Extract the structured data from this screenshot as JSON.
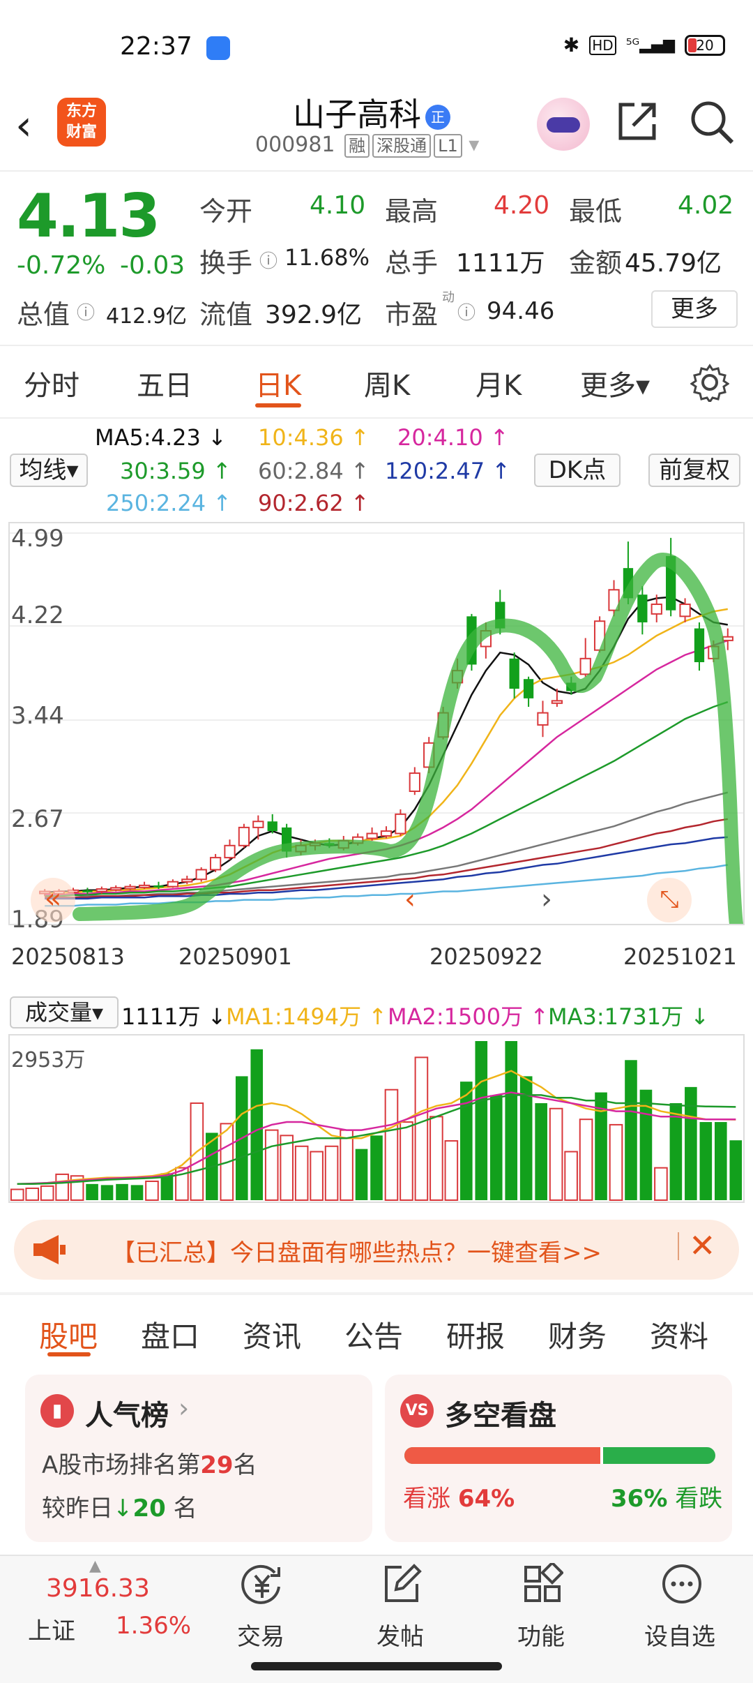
{
  "status": {
    "time": "22:37",
    "battery": "20"
  },
  "header": {
    "logo_line1": "东方",
    "logo_line2": "财富",
    "name": "山子高科",
    "badge": "正",
    "code": "000981",
    "tags": [
      "融",
      "深股通",
      "L1"
    ]
  },
  "quote": {
    "price": "4.13",
    "change_pct": "-0.72%",
    "change": "-0.03",
    "open_label": "今开",
    "open": "4.10",
    "high_label": "最高",
    "high": "4.20",
    "low_label": "最低",
    "low": "4.02",
    "turnover_label": "换手",
    "turnover": "11.68%",
    "volume_label": "总手",
    "volume": "1111万",
    "amount_label": "金额",
    "amount": "45.79亿",
    "mktcap_label": "总值",
    "mktcap": "412.9亿",
    "float_label": "流值",
    "float": "392.9亿",
    "pe_label": "市盈",
    "pe_sup": "动",
    "pe": "94.46",
    "more": "更多"
  },
  "ktabs": [
    {
      "label": "分时"
    },
    {
      "label": "五日"
    },
    {
      "label": "日K"
    },
    {
      "label": "周K"
    },
    {
      "label": "月K"
    },
    {
      "label": "更多▾"
    }
  ],
  "ma": {
    "selector": "均线▾",
    "ma5": "MA5:4.23 ↓",
    "ma10": "10:4.36 ↑",
    "ma20": "20:4.10 ↑",
    "ma30": "30:3.59 ↑",
    "ma60": "60:2.84 ↑",
    "ma120": "120:2.47 ↑",
    "ma250": "250:2.24 ↑",
    "ma90": "90:2.62 ↑",
    "dk": "DK点",
    "fq": "前复权"
  },
  "chart_data": {
    "type": "candlestick",
    "y_ticks": [
      "4.99",
      "4.22",
      "3.44",
      "2.67",
      "1.89"
    ],
    "ylim": [
      1.89,
      4.99
    ],
    "x_ticks": [
      "20250813",
      "20250901",
      "20250922",
      "20251021"
    ],
    "candles": [
      {
        "o": 2.02,
        "c": 2.02,
        "h": 2.04,
        "l": 1.98,
        "up": true
      },
      {
        "o": 2.0,
        "c": 2.02,
        "h": 2.04,
        "l": 1.98,
        "up": true
      },
      {
        "o": 2.02,
        "c": 2.03,
        "h": 2.05,
        "l": 2.0,
        "up": true
      },
      {
        "o": 2.03,
        "c": 2.02,
        "h": 2.05,
        "l": 2.0,
        "up": false
      },
      {
        "o": 2.02,
        "c": 2.04,
        "h": 2.06,
        "l": 2.0,
        "up": true
      },
      {
        "o": 2.04,
        "c": 2.05,
        "h": 2.07,
        "l": 2.02,
        "up": true
      },
      {
        "o": 2.05,
        "c": 2.06,
        "h": 2.08,
        "l": 2.03,
        "up": true
      },
      {
        "o": 2.06,
        "c": 2.07,
        "h": 2.1,
        "l": 2.04,
        "up": true
      },
      {
        "o": 2.07,
        "c": 2.06,
        "h": 2.1,
        "l": 2.04,
        "up": false
      },
      {
        "o": 2.06,
        "c": 2.1,
        "h": 2.12,
        "l": 2.05,
        "up": true
      },
      {
        "o": 2.1,
        "c": 2.12,
        "h": 2.15,
        "l": 2.08,
        "up": true
      },
      {
        "o": 2.12,
        "c": 2.2,
        "h": 2.22,
        "l": 2.1,
        "up": true
      },
      {
        "o": 2.2,
        "c": 2.3,
        "h": 2.33,
        "l": 2.18,
        "up": true
      },
      {
        "o": 2.3,
        "c": 2.4,
        "h": 2.45,
        "l": 2.28,
        "up": true
      },
      {
        "o": 2.4,
        "c": 2.55,
        "h": 2.58,
        "l": 2.38,
        "up": true
      },
      {
        "o": 2.55,
        "c": 2.6,
        "h": 2.65,
        "l": 2.45,
        "up": true
      },
      {
        "o": 2.6,
        "c": 2.52,
        "h": 2.66,
        "l": 2.5,
        "up": false
      },
      {
        "o": 2.55,
        "c": 2.35,
        "h": 2.58,
        "l": 2.3,
        "up": false
      },
      {
        "o": 2.35,
        "c": 2.4,
        "h": 2.45,
        "l": 2.32,
        "up": true
      },
      {
        "o": 2.4,
        "c": 2.42,
        "h": 2.45,
        "l": 2.36,
        "up": true
      },
      {
        "o": 2.42,
        "c": 2.4,
        "h": 2.46,
        "l": 2.38,
        "up": false
      },
      {
        "o": 2.38,
        "c": 2.44,
        "h": 2.48,
        "l": 2.36,
        "up": true
      },
      {
        "o": 2.42,
        "c": 2.47,
        "h": 2.5,
        "l": 2.4,
        "up": true
      },
      {
        "o": 2.46,
        "c": 2.5,
        "h": 2.55,
        "l": 2.44,
        "up": true
      },
      {
        "o": 2.48,
        "c": 2.52,
        "h": 2.56,
        "l": 2.46,
        "up": true
      },
      {
        "o": 2.5,
        "c": 2.66,
        "h": 2.7,
        "l": 2.48,
        "up": true
      },
      {
        "o": 2.85,
        "c": 3.0,
        "h": 3.05,
        "l": 2.82,
        "up": true
      },
      {
        "o": 3.05,
        "c": 3.25,
        "h": 3.3,
        "l": 3.0,
        "up": true
      },
      {
        "o": 3.3,
        "c": 3.5,
        "h": 3.55,
        "l": 3.28,
        "up": true
      },
      {
        "o": 3.75,
        "c": 3.85,
        "h": 3.95,
        "l": 3.7,
        "up": true
      },
      {
        "o": 4.3,
        "c": 3.9,
        "h": 4.32,
        "l": 3.85,
        "up": false
      },
      {
        "o": 4.05,
        "c": 4.18,
        "h": 4.25,
        "l": 3.95,
        "up": true
      },
      {
        "o": 4.42,
        "c": 4.2,
        "h": 4.52,
        "l": 4.15,
        "up": false
      },
      {
        "o": 3.95,
        "c": 3.7,
        "h": 4.0,
        "l": 3.62,
        "up": false
      },
      {
        "o": 3.78,
        "c": 3.62,
        "h": 3.8,
        "l": 3.55,
        "up": false
      },
      {
        "o": 3.5,
        "c": 3.4,
        "h": 3.6,
        "l": 3.3,
        "up": true
      },
      {
        "o": 3.58,
        "c": 3.6,
        "h": 3.7,
        "l": 3.55,
        "up": true
      },
      {
        "o": 3.75,
        "c": 3.68,
        "h": 3.8,
        "l": 3.65,
        "up": false
      },
      {
        "o": 3.82,
        "c": 3.95,
        "h": 4.12,
        "l": 3.8,
        "up": true
      },
      {
        "o": 4.02,
        "c": 4.26,
        "h": 4.3,
        "l": 4.0,
        "up": true
      },
      {
        "o": 4.52,
        "c": 4.35,
        "h": 4.6,
        "l": 4.3,
        "up": true
      },
      {
        "o": 4.7,
        "c": 4.45,
        "h": 4.92,
        "l": 4.4,
        "up": false
      },
      {
        "o": 4.48,
        "c": 4.25,
        "h": 4.55,
        "l": 4.15,
        "up": false
      },
      {
        "o": 4.32,
        "c": 4.4,
        "h": 4.48,
        "l": 4.25,
        "up": true
      },
      {
        "o": 4.8,
        "c": 4.35,
        "h": 4.95,
        "l": 4.3,
        "up": false
      },
      {
        "o": 4.4,
        "c": 4.3,
        "h": 4.45,
        "l": 4.25,
        "up": true
      },
      {
        "o": 4.2,
        "c": 3.92,
        "h": 4.25,
        "l": 3.85,
        "up": false
      },
      {
        "o": 4.05,
        "c": 3.95,
        "h": 4.1,
        "l": 3.92,
        "up": true
      },
      {
        "o": 4.1,
        "c": 4.13,
        "h": 4.2,
        "l": 4.02,
        "up": true
      }
    ],
    "ma_lines": [
      {
        "name": "MA5",
        "color": "#111111",
        "values": [
          2.01,
          2.02,
          2.02,
          2.03,
          2.03,
          2.04,
          2.05,
          2.06,
          2.06,
          2.08,
          2.1,
          2.14,
          2.2,
          2.28,
          2.38,
          2.48,
          2.52,
          2.48,
          2.45,
          2.42,
          2.4,
          2.41,
          2.43,
          2.46,
          2.48,
          2.55,
          2.7,
          2.9,
          3.15,
          3.4,
          3.65,
          3.85,
          4.0,
          3.98,
          3.9,
          3.75,
          3.68,
          3.66,
          3.7,
          3.85,
          4.05,
          4.28,
          4.42,
          4.45,
          4.46,
          4.4,
          4.32,
          4.25,
          4.23
        ]
      },
      {
        "name": "MA10",
        "color": "#f0b419",
        "values": [
          2.0,
          2.01,
          2.01,
          2.02,
          2.02,
          2.03,
          2.03,
          2.04,
          2.05,
          2.06,
          2.07,
          2.09,
          2.12,
          2.16,
          2.22,
          2.28,
          2.34,
          2.38,
          2.4,
          2.42,
          2.44,
          2.44,
          2.44,
          2.45,
          2.46,
          2.48,
          2.55,
          2.64,
          2.76,
          2.9,
          3.08,
          3.28,
          3.48,
          3.62,
          3.72,
          3.78,
          3.8,
          3.82,
          3.85,
          3.88,
          3.92,
          3.98,
          4.06,
          4.14,
          4.2,
          4.26,
          4.3,
          4.34,
          4.36
        ]
      },
      {
        "name": "MA20",
        "color": "#d6279e",
        "values": [
          1.99,
          1.99,
          2.0,
          2.0,
          2.01,
          2.01,
          2.02,
          2.02,
          2.03,
          2.04,
          2.05,
          2.06,
          2.07,
          2.09,
          2.11,
          2.14,
          2.17,
          2.2,
          2.23,
          2.26,
          2.29,
          2.31,
          2.33,
          2.35,
          2.37,
          2.4,
          2.44,
          2.49,
          2.55,
          2.62,
          2.7,
          2.8,
          2.9,
          3.0,
          3.1,
          3.2,
          3.3,
          3.38,
          3.46,
          3.54,
          3.62,
          3.7,
          3.78,
          3.86,
          3.92,
          3.98,
          4.02,
          4.06,
          4.1
        ]
      },
      {
        "name": "MA30",
        "color": "#1d9a2a",
        "values": [
          1.98,
          1.98,
          1.99,
          1.99,
          2.0,
          2.0,
          2.01,
          2.01,
          2.02,
          2.02,
          2.03,
          2.04,
          2.05,
          2.06,
          2.08,
          2.1,
          2.12,
          2.14,
          2.16,
          2.18,
          2.2,
          2.22,
          2.24,
          2.26,
          2.28,
          2.3,
          2.33,
          2.36,
          2.4,
          2.45,
          2.5,
          2.56,
          2.62,
          2.68,
          2.74,
          2.8,
          2.86,
          2.92,
          2.98,
          3.04,
          3.1,
          3.17,
          3.24,
          3.31,
          3.38,
          3.45,
          3.5,
          3.55,
          3.59
        ]
      },
      {
        "name": "MA60",
        "color": "#777777",
        "values": [
          1.97,
          1.97,
          1.97,
          1.98,
          1.98,
          1.98,
          1.99,
          1.99,
          2.0,
          2.0,
          2.01,
          2.01,
          2.02,
          2.03,
          2.04,
          2.05,
          2.06,
          2.07,
          2.08,
          2.09,
          2.1,
          2.11,
          2.12,
          2.13,
          2.14,
          2.16,
          2.17,
          2.19,
          2.21,
          2.23,
          2.26,
          2.29,
          2.32,
          2.35,
          2.38,
          2.41,
          2.44,
          2.47,
          2.5,
          2.53,
          2.56,
          2.6,
          2.64,
          2.68,
          2.71,
          2.75,
          2.78,
          2.81,
          2.84
        ]
      },
      {
        "name": "MA90",
        "color": "#b3262e",
        "values": [
          1.97,
          1.97,
          1.97,
          1.97,
          1.98,
          1.98,
          1.98,
          1.99,
          1.99,
          1.99,
          2.0,
          2.0,
          2.01,
          2.01,
          2.02,
          2.03,
          2.03,
          2.04,
          2.05,
          2.06,
          2.07,
          2.08,
          2.09,
          2.1,
          2.11,
          2.12,
          2.13,
          2.15,
          2.16,
          2.18,
          2.2,
          2.22,
          2.24,
          2.26,
          2.28,
          2.3,
          2.32,
          2.34,
          2.36,
          2.38,
          2.41,
          2.44,
          2.47,
          2.5,
          2.52,
          2.55,
          2.57,
          2.6,
          2.62
        ]
      },
      {
        "name": "MA120",
        "color": "#1f3aa5",
        "values": [
          1.96,
          1.96,
          1.96,
          1.96,
          1.97,
          1.97,
          1.97,
          1.97,
          1.98,
          1.98,
          1.98,
          1.99,
          1.99,
          2.0,
          2.0,
          2.01,
          2.01,
          2.02,
          2.03,
          2.03,
          2.04,
          2.05,
          2.06,
          2.07,
          2.08,
          2.09,
          2.1,
          2.11,
          2.12,
          2.14,
          2.15,
          2.17,
          2.18,
          2.2,
          2.22,
          2.24,
          2.25,
          2.27,
          2.29,
          2.31,
          2.33,
          2.35,
          2.37,
          2.39,
          2.41,
          2.42,
          2.44,
          2.46,
          2.47
        ]
      },
      {
        "name": "MA250",
        "color": "#5ab4e0",
        "values": [
          1.9,
          1.9,
          1.9,
          1.91,
          1.91,
          1.91,
          1.92,
          1.92,
          1.92,
          1.93,
          1.93,
          1.93,
          1.94,
          1.94,
          1.95,
          1.95,
          1.95,
          1.96,
          1.96,
          1.97,
          1.97,
          1.98,
          1.98,
          1.99,
          1.99,
          2.0,
          2.0,
          2.01,
          2.02,
          2.02,
          2.03,
          2.04,
          2.05,
          2.06,
          2.07,
          2.08,
          2.09,
          2.1,
          2.11,
          2.12,
          2.13,
          2.14,
          2.15,
          2.17,
          2.18,
          2.19,
          2.21,
          2.22,
          2.24
        ]
      }
    ],
    "volume": {
      "label": "成交量▾",
      "current": "1111万 ↓",
      "ma1": "MA1:1494万 ↑",
      "ma2": "MA2:1500万 ↑",
      "ma3": "MA3:1731万 ↓",
      "max_label": "2953万",
      "max": 2953,
      "bars": [
        200,
        220,
        260,
        480,
        450,
        300,
        280,
        300,
        280,
        350,
        500,
        600,
        1800,
        1250,
        1420,
        2300,
        2800,
        1300,
        1200,
        1000,
        900,
        1000,
        1300,
        950,
        1200,
        2050,
        1450,
        2650,
        1550,
        1100,
        2200,
        2953,
        1950,
        2953,
        2300,
        1800,
        1700,
        900,
        1500,
        2000,
        1400,
        2600,
        2050,
        600,
        1800,
        2100,
        1450,
        1450,
        1111
      ],
      "bar_up": [
        true,
        true,
        true,
        true,
        true,
        false,
        false,
        false,
        false,
        true,
        false,
        true,
        true,
        false,
        true,
        false,
        false,
        true,
        true,
        true,
        true,
        true,
        true,
        false,
        false,
        true,
        true,
        true,
        true,
        true,
        false,
        false,
        false,
        false,
        false,
        false,
        true,
        true,
        true,
        false,
        true,
        false,
        false,
        true,
        false,
        false,
        false,
        false,
        false
      ],
      "ma_lines": [
        {
          "name": "MA1",
          "color": "#f0b419",
          "values": [
            300,
            300,
            320,
            350,
            380,
            400,
            420,
            420,
            430,
            450,
            500,
            650,
            900,
            1100,
            1300,
            1600,
            1750,
            1800,
            1750,
            1600,
            1400,
            1200,
            1150,
            1150,
            1250,
            1350,
            1500,
            1650,
            1750,
            1800,
            1950,
            2200,
            2300,
            2400,
            2250,
            2100,
            1900,
            1800,
            1700,
            1650,
            1700,
            1750,
            1750,
            1650,
            1600,
            1550,
            1500,
            1500,
            1494
          ]
        },
        {
          "name": "MA2",
          "color": "#d6279e",
          "values": [
            300,
            310,
            320,
            340,
            360,
            380,
            400,
            410,
            420,
            430,
            460,
            550,
            700,
            850,
            1000,
            1150,
            1300,
            1400,
            1450,
            1450,
            1400,
            1350,
            1300,
            1300,
            1350,
            1400,
            1500,
            1600,
            1700,
            1750,
            1800,
            1900,
            1950,
            2000,
            1950,
            1900,
            1850,
            1800,
            1750,
            1700,
            1650,
            1650,
            1600,
            1550,
            1550,
            1520,
            1500,
            1500,
            1500
          ]
        },
        {
          "name": "MA3",
          "color": "#1d9a2a",
          "values": [
            300,
            300,
            310,
            320,
            340,
            360,
            380,
            390,
            400,
            410,
            430,
            480,
            550,
            620,
            700,
            800,
            900,
            1000,
            1050,
            1100,
            1150,
            1150,
            1150,
            1200,
            1250,
            1300,
            1350,
            1450,
            1550,
            1650,
            1750,
            1850,
            1900,
            1950,
            1950,
            1950,
            1900,
            1900,
            1850,
            1850,
            1800,
            1800,
            1800,
            1780,
            1760,
            1750,
            1740,
            1735,
            1731
          ]
        }
      ]
    }
  },
  "banner": {
    "text": "【已汇总】今日盘面有哪些热点？一键查看>>"
  },
  "bottom_tabs": [
    {
      "label": "股吧"
    },
    {
      "label": "盘口"
    },
    {
      "label": "资讯"
    },
    {
      "label": "公告"
    },
    {
      "label": "研报"
    },
    {
      "label": "财务"
    },
    {
      "label": "资料"
    }
  ],
  "cards": {
    "popularity": {
      "title": "人气榜",
      "rank_prefix": "A股市场排名第",
      "rank": "29",
      "rank_suffix": "名",
      "compare_prefix": "较昨日",
      "compare_value": "20",
      "compare_suffix": "名"
    },
    "sentiment": {
      "title": "多空看盘",
      "bull_label": "看涨",
      "bull_pct": "64%",
      "bear_label": "看跌",
      "bear_pct": "36%",
      "bull_value": 64,
      "bull_color": "#ef5a45",
      "bear_color": "#2aae4a"
    }
  },
  "nav": {
    "index_value": "3916.33",
    "index_name": "上证",
    "index_change": "1.36%",
    "items": [
      {
        "label": "交易"
      },
      {
        "label": "发帖"
      },
      {
        "label": "功能"
      },
      {
        "label": "设自选"
      }
    ]
  }
}
